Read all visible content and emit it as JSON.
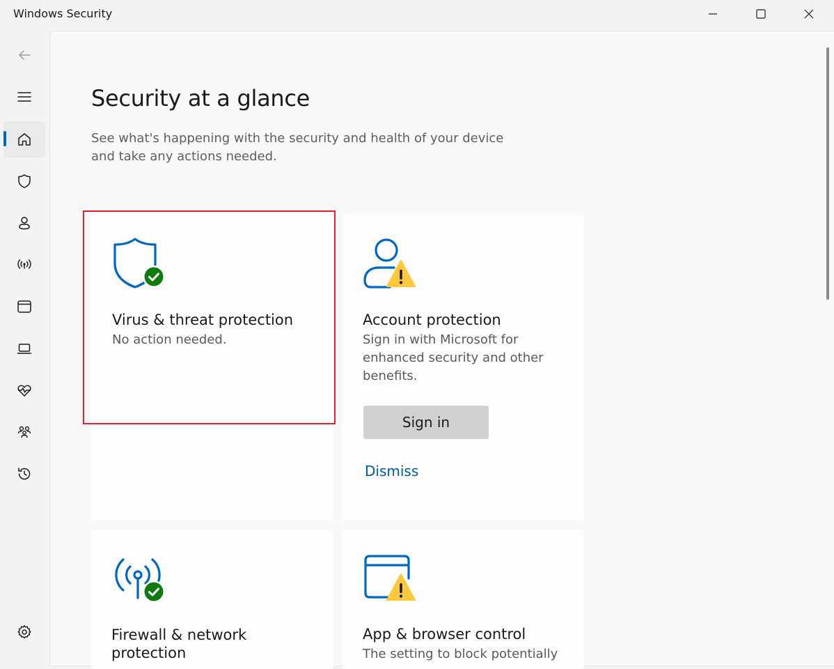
{
  "window": {
    "title": "Windows Security"
  },
  "nav": {
    "items": [
      {
        "name": "back-arrow-icon"
      },
      {
        "name": "hamburger-menu-icon"
      },
      {
        "name": "home-icon",
        "active": true
      },
      {
        "name": "shield-icon"
      },
      {
        "name": "person-icon"
      },
      {
        "name": "wireless-antenna-icon"
      },
      {
        "name": "browser-window-icon"
      },
      {
        "name": "laptop-icon"
      },
      {
        "name": "heart-pulse-icon"
      },
      {
        "name": "family-icon"
      },
      {
        "name": "history-icon"
      },
      {
        "name": "settings-gear-icon"
      }
    ]
  },
  "page": {
    "title": "Security at a glance",
    "subtitle": "See what's happening with the security and health of your device and take any actions needed."
  },
  "cards": {
    "virus": {
      "icon": "shield-check-icon",
      "title": "Virus & threat protection",
      "desc": "No action needed."
    },
    "account": {
      "icon": "person-warning-icon",
      "title": "Account protection",
      "desc": "Sign in with Microsoft for enhanced security and other benefits.",
      "button": "Sign in",
      "link": "Dismiss"
    },
    "firewall": {
      "icon": "antenna-check-icon",
      "title": "Firewall & network protection"
    },
    "app_browser": {
      "icon": "window-warning-icon",
      "title": "App & browser control",
      "desc": "The setting to block potentially"
    }
  },
  "colors": {
    "accent": "#0067c0",
    "ok": "#0f7b0f",
    "warning": "#ffc83d",
    "highlight": "#e0202e"
  }
}
